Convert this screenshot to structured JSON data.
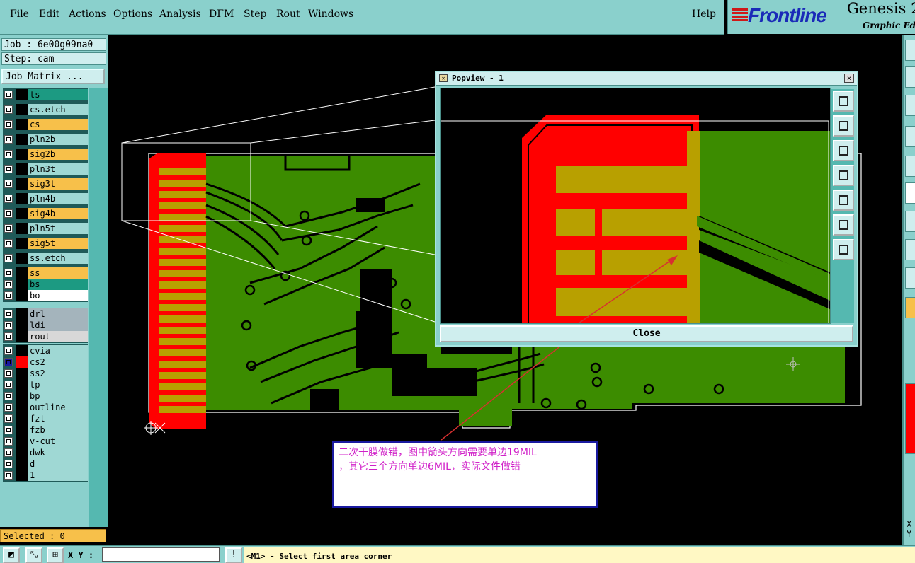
{
  "menubar": {
    "items": [
      "File",
      "Edit",
      "Actions",
      "Options",
      "Analysis",
      "DFM",
      "Step",
      "Rout",
      "Windows"
    ],
    "help": "Help"
  },
  "logo": {
    "brand": "Frontline",
    "product": "Genesis 2",
    "subtitle": "Graphic Edit"
  },
  "left": {
    "job": "Job : 6e00g09na0",
    "step": "Step: cam",
    "job_matrix": "Job Matrix ...",
    "layers": [
      {
        "name": "ts",
        "color": "#1c9a82"
      },
      {
        "name": "cs.etch",
        "color": "#9fd8d4"
      },
      {
        "name": "cs",
        "color": "#f7c04a"
      },
      {
        "name": "pln2b",
        "color": "#9fd8d4"
      },
      {
        "name": "sig2b",
        "color": "#f7c04a"
      },
      {
        "name": "pln3t",
        "color": "#9fd8d4"
      },
      {
        "name": "sig3t",
        "color": "#f7c04a"
      },
      {
        "name": "pln4b",
        "color": "#9fd8d4"
      },
      {
        "name": "sig4b",
        "color": "#f7c04a"
      },
      {
        "name": "pln5t",
        "color": "#9fd8d4"
      },
      {
        "name": "sig5t",
        "color": "#f7c04a"
      },
      {
        "name": "ss.etch",
        "color": "#9fd8d4"
      },
      {
        "name": "ss",
        "color": "#f7c04a"
      },
      {
        "name": "bs",
        "color": "#1c9a82"
      },
      {
        "name": "bo",
        "color": "#ffffff"
      },
      {
        "name": "drl",
        "color": "#a4b4bc"
      },
      {
        "name": "ldi",
        "color": "#a4b4bc"
      },
      {
        "name": "rout",
        "color": "#d8d8d8"
      },
      {
        "name": "cvia",
        "color": "#9fd8d4"
      },
      {
        "name": "cs2",
        "color": "#9fd8d4"
      },
      {
        "name": "ss2",
        "color": "#9fd8d4"
      },
      {
        "name": "tp",
        "color": "#9fd8d4"
      },
      {
        "name": "bp",
        "color": "#9fd8d4"
      },
      {
        "name": "outline",
        "color": "#9fd8d4"
      },
      {
        "name": "fzt",
        "color": "#9fd8d4"
      },
      {
        "name": "fzb",
        "color": "#9fd8d4"
      },
      {
        "name": "v-cut",
        "color": "#9fd8d4"
      },
      {
        "name": "dwk",
        "color": "#9fd8d4"
      },
      {
        "name": "d",
        "color": "#9fd8d4"
      },
      {
        "name": "1",
        "color": "#9fd8d4"
      }
    ],
    "selected": "Selected : 0"
  },
  "popview": {
    "title": "Popview - 1",
    "close": "Close"
  },
  "annotation": {
    "line1": "二次干膜做错，图中箭头方向需要单边19MIL",
    "line2": "，其它三个方向单边6MIL，实际文件做错"
  },
  "bottom": {
    "xy_label": "X Y :",
    "status": "<M1> - Select first area corner"
  },
  "right": {
    "xy": "X\nY"
  },
  "colors": {
    "panel": "#8ad0cc",
    "board": "#3c8c00",
    "copper": "#b8a000",
    "mask": "#ff0000"
  }
}
